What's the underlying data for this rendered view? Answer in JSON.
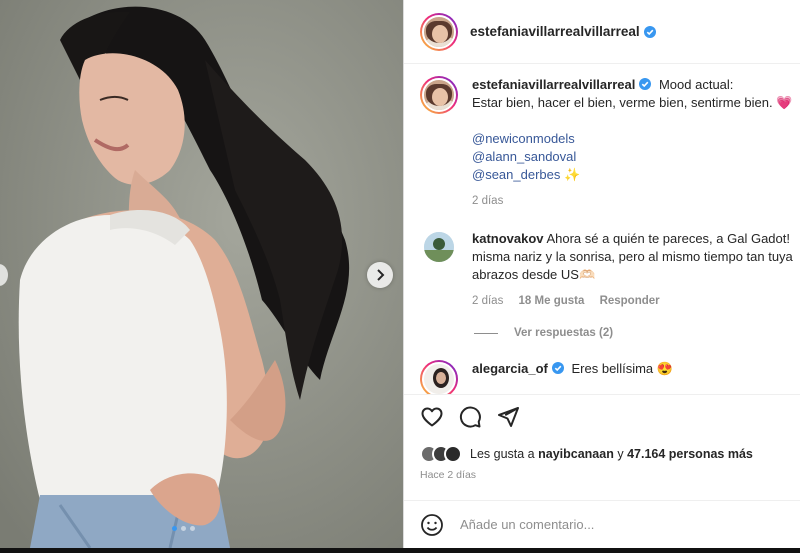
{
  "post": {
    "username": "estefaniavillarrealvillarreal",
    "caption_intro": "Mood actual:",
    "caption_line2": "Estar bien, hacer el bien, verme bien, sentirme bien. 💗",
    "mentions": [
      "@newiconmodels",
      "@alann_sandoval",
      "@sean_derbes ✨"
    ],
    "time": "2 días"
  },
  "comments": [
    {
      "username": "katnovakov",
      "text": "Ahora sé a quién te pareces, a Gal Gadot! misma nariz y la sonrisa, pero al mismo tiempo tan tuya abrazos desde US🫶🏻",
      "time": "2 días",
      "likes": "18 Me gusta",
      "reply_label": "Responder",
      "view_replies": "Ver respuestas (2)"
    },
    {
      "username": "alegarcia_of",
      "text": "Eres bellísima 😍"
    }
  ],
  "likes": {
    "prefix": "Les gusta a",
    "user": "nayibcanaan",
    "conj": "y",
    "count": "47.164 personas más"
  },
  "time_ago": "Hace 2 días",
  "add_comment_placeholder": "Añade un comentario...",
  "colors": {
    "verified": "#3897f0",
    "mention": "#385898",
    "muted": "#8e8e8e"
  }
}
